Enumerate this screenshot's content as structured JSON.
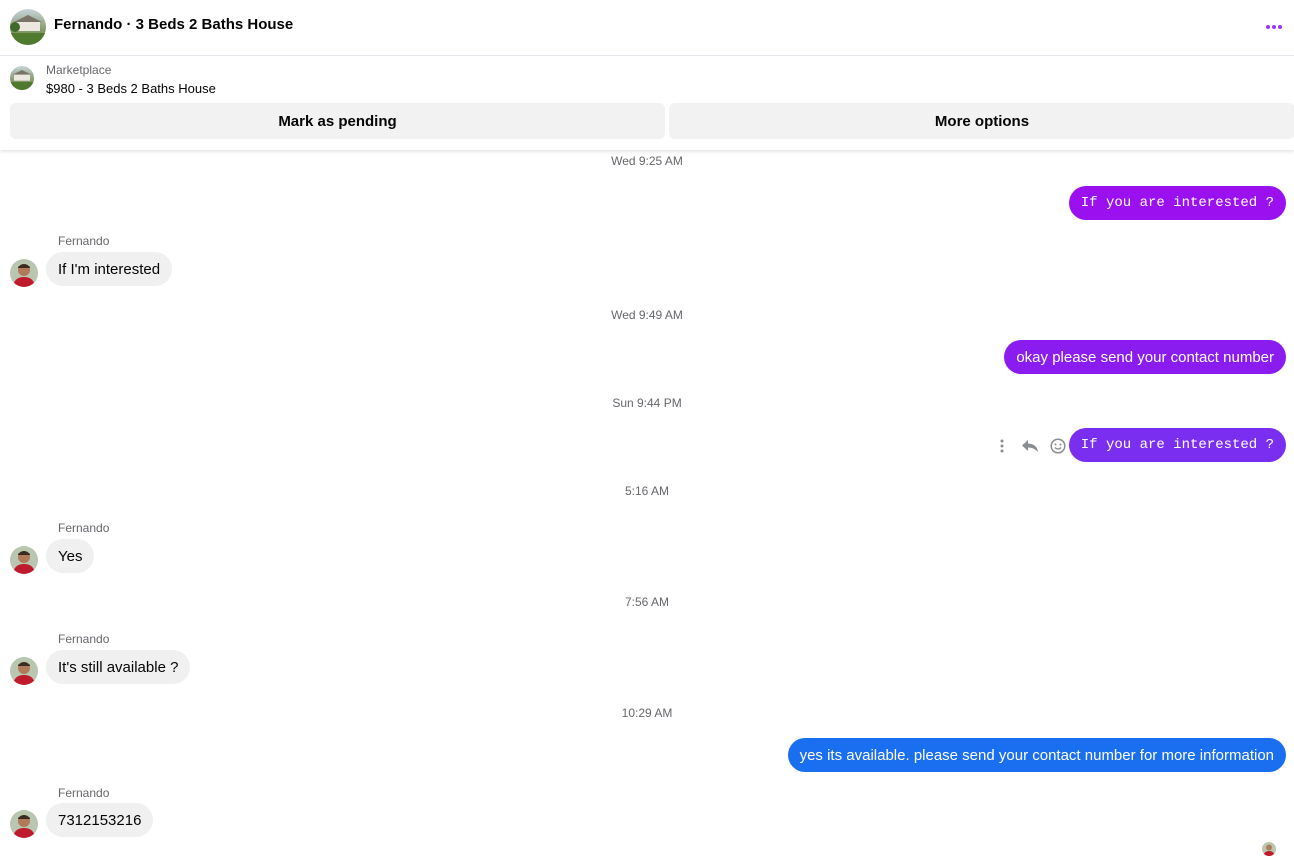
{
  "header": {
    "title": "Fernando · 3 Beds 2 Baths House",
    "accent_color": "#a033ff"
  },
  "listing": {
    "source": "Marketplace",
    "name": "$980 - 3 Beds 2 Baths House",
    "mark_pending_label": "Mark as pending",
    "more_options_label": "More options"
  },
  "timestamps": [
    "Wed 9:25 AM",
    "Wed 9:49 AM",
    "Sun 9:44 PM",
    "5:16 AM",
    "7:56 AM",
    "10:29 AM"
  ],
  "messages": [
    {
      "from": "me",
      "text": "If you are interested ?",
      "color": "#9b10ef"
    },
    {
      "from": "Fernando",
      "sender_label": "Fernando",
      "text": "If I'm interested"
    },
    {
      "from": "me",
      "text": "okay please send your contact number",
      "color": "#8a1cf0"
    },
    {
      "from": "me",
      "text": "If you are interested ?",
      "color": "#7a2ff0"
    },
    {
      "from": "Fernando",
      "sender_label": "Fernando",
      "text": "Yes"
    },
    {
      "from": "Fernando",
      "sender_label": "Fernando",
      "text": "It's still available ?"
    },
    {
      "from": "me",
      "text": "yes its available. please send your contact number for more information",
      "color": "#1a6ef0"
    },
    {
      "from": "Fernando",
      "sender_label": "Fernando",
      "text": "7312153216"
    }
  ],
  "icons": {
    "more": "more-horizontal-icon",
    "message_actions": [
      "more-vertical-icon",
      "reply-icon",
      "emoji-icon"
    ]
  }
}
